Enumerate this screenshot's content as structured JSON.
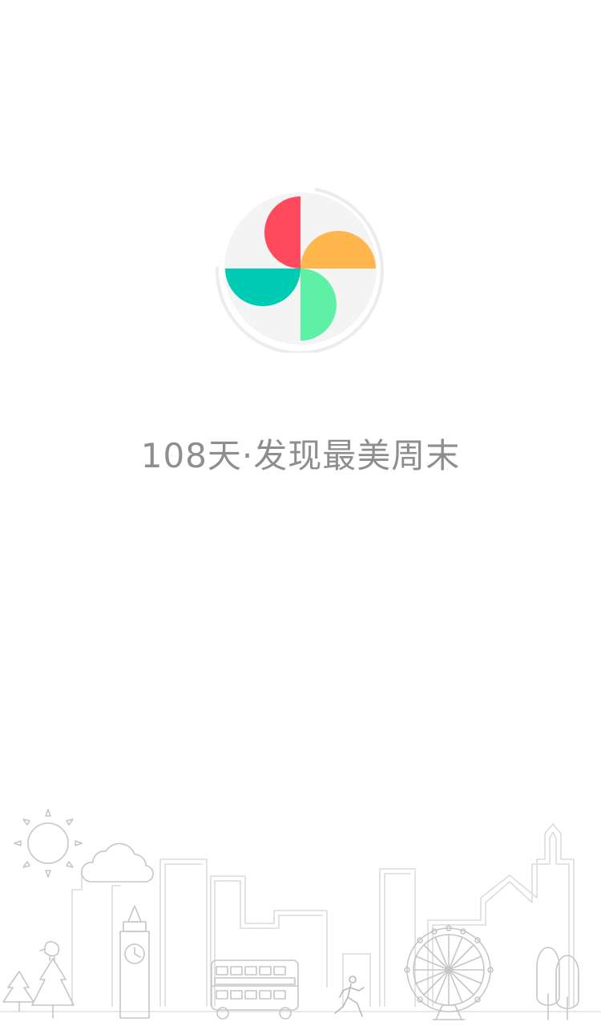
{
  "app": {
    "tagline": "108天·发现最美周末"
  },
  "logo": {
    "icon": "pinwheel-logo",
    "colors": {
      "red": "#ff4a5e",
      "orange": "#ffb74d",
      "teal": "#00ccb4",
      "green": "#5ef0a5",
      "circle": "#f4f4f4",
      "ring": "#ececec"
    }
  },
  "illustration": {
    "icon": "city-skyline-illustration",
    "line_color": "#c6c6c6"
  }
}
